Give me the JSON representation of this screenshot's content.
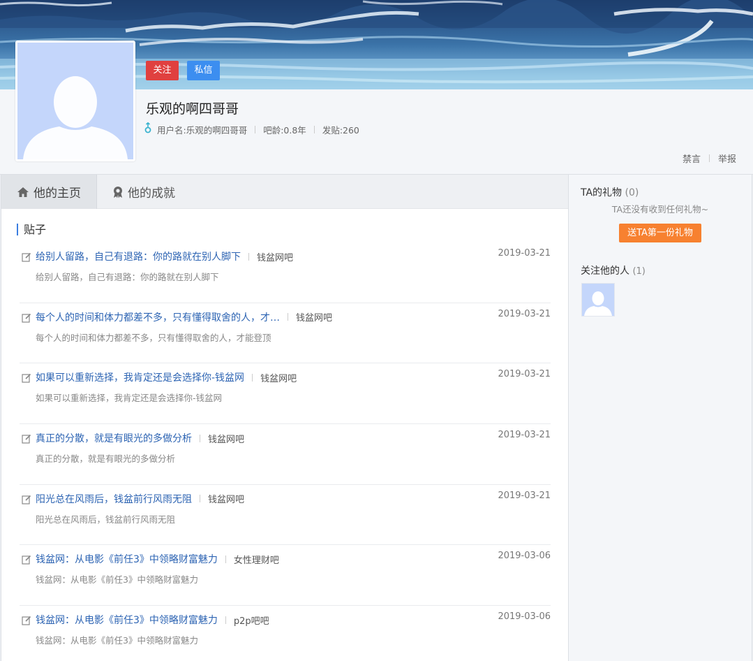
{
  "profile": {
    "follow_label": "关注",
    "message_label": "私信",
    "username": "乐观的啊四哥哥",
    "gender_icon": "male-icon",
    "username_meta": "用户名:乐观的啊四哥哥",
    "age": "吧龄:0.8年",
    "posts_count": "发贴:260",
    "ban_label": "禁言",
    "report_label": "举报"
  },
  "tabs": [
    {
      "label": "他的主页",
      "icon": "home-icon",
      "active": true
    },
    {
      "label": "他的成就",
      "icon": "medal-icon",
      "active": false
    }
  ],
  "section_title": "贴子",
  "posts": [
    {
      "title": "给别人留路，自己有退路：你的路就在别人脚下",
      "bar": "钱盆网吧",
      "date": "2019-03-21",
      "desc": "给别人留路，自己有退路：你的路就在别人脚下"
    },
    {
      "title": "每个人的时间和体力都差不多，只有懂得取舍的人，才…",
      "bar": "钱盆网吧",
      "date": "2019-03-21",
      "desc": "每个人的时间和体力都差不多，只有懂得取舍的人，才能登顶"
    },
    {
      "title": "如果可以重新选择，我肯定还是会选择你-钱盆网",
      "bar": "钱盆网吧",
      "date": "2019-03-21",
      "desc": "如果可以重新选择，我肯定还是会选择你-钱盆网"
    },
    {
      "title": "真正的分散，就是有眼光的多做分析",
      "bar": "钱盆网吧",
      "date": "2019-03-21",
      "desc": "真正的分散，就是有眼光的多做分析"
    },
    {
      "title": "阳光总在风雨后，钱盆前行风雨无阻",
      "bar": "钱盆网吧",
      "date": "2019-03-21",
      "desc": "阳光总在风雨后，钱盆前行风雨无阻"
    },
    {
      "title": "钱盆网：从电影《前任3》中领略财富魅力",
      "bar": "女性理财吧",
      "date": "2019-03-06",
      "desc": "钱盆网：从电影《前任3》中领略财富魅力"
    },
    {
      "title": "钱盆网：从电影《前任3》中领略财富魅力",
      "bar": "p2p吧吧",
      "date": "2019-03-06",
      "desc": "钱盆网：从电影《前任3》中领略财富魅力"
    }
  ],
  "sidebar": {
    "gift_title": "TA的礼物",
    "gift_count": "(0)",
    "gift_empty": "TA还没有收到任何礼物~",
    "gift_button": "送TA第一份礼物",
    "fans_title": "关注他的人",
    "fans_count": "(1)"
  },
  "colors": {
    "follow": "#e0403f",
    "message": "#3c8ef0",
    "link": "#2d64b3",
    "gift_button": "#f78130",
    "avatar_bg": "#c4d6fb"
  }
}
